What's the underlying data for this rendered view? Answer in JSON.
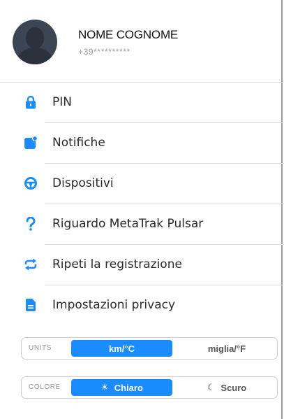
{
  "profile": {
    "name": "NOME COGNOME",
    "phone": "+39**********"
  },
  "menu": [
    {
      "label": "PIN",
      "icon": "lock-icon"
    },
    {
      "label": "Notifiche",
      "icon": "notification-icon"
    },
    {
      "label": "Dispositivi",
      "icon": "steering-wheel-icon"
    },
    {
      "label": "Riguardo MetaTrak Pulsar",
      "icon": "question-icon"
    },
    {
      "label": "Ripeti la registrazione",
      "icon": "repeat-icon"
    },
    {
      "label": "Impostazioni privacy",
      "icon": "document-icon"
    }
  ],
  "units": {
    "label": "UNITS",
    "options": [
      "km/°C",
      "miglia/°F"
    ],
    "selected": "km/°C"
  },
  "theme": {
    "label": "COLORE",
    "options": [
      "Chiaro",
      "Scuro"
    ],
    "selected": "Chiaro",
    "icons": [
      "sun-icon",
      "moon-icon"
    ]
  },
  "colors": {
    "accent": "#1a8cff",
    "text": "#2a2a2a",
    "muted": "#9c9c9c"
  }
}
